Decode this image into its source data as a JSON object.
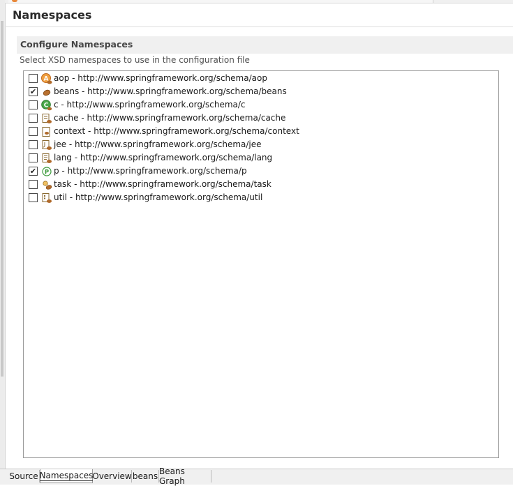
{
  "page": {
    "title": "Namespaces"
  },
  "section": {
    "title": "Configure Namespaces",
    "description": "Select XSD namespaces to use in the configuration file"
  },
  "namespaces": [
    {
      "label": "aop - http://www.springframework.org/schema/aop",
      "checked": false,
      "icon": "aop-icon"
    },
    {
      "label": "beans - http://www.springframework.org/schema/beans",
      "checked": true,
      "icon": "beans-icon"
    },
    {
      "label": "c - http://www.springframework.org/schema/c",
      "checked": false,
      "icon": "c-namespace-icon"
    },
    {
      "label": "cache - http://www.springframework.org/schema/cache",
      "checked": false,
      "icon": "cache-icon"
    },
    {
      "label": "context - http://www.springframework.org/schema/context",
      "checked": false,
      "icon": "context-icon"
    },
    {
      "label": "jee - http://www.springframework.org/schema/jee",
      "checked": false,
      "icon": "jee-icon"
    },
    {
      "label": "lang - http://www.springframework.org/schema/lang",
      "checked": false,
      "icon": "lang-icon"
    },
    {
      "label": "p - http://www.springframework.org/schema/p",
      "checked": true,
      "icon": "p-namespace-icon"
    },
    {
      "label": "task - http://www.springframework.org/schema/task",
      "checked": false,
      "icon": "task-icon"
    },
    {
      "label": "util - http://www.springframework.org/schema/util",
      "checked": false,
      "icon": "util-icon"
    }
  ],
  "tabs": [
    {
      "label": "Source",
      "active": false
    },
    {
      "label": "Namespaces",
      "active": true
    },
    {
      "label": "Overview",
      "active": false
    },
    {
      "label": "beans",
      "active": false
    },
    {
      "label": "Beans Graph",
      "active": false
    }
  ],
  "colors": {
    "section_header_bg": "#f0f0f0",
    "check_mark": "#222222",
    "aop_icon": "#e07a2a",
    "c_icon": "#3a9a3a",
    "p_icon": "#3a9a3a",
    "bean_brown": "#b06a2a"
  }
}
